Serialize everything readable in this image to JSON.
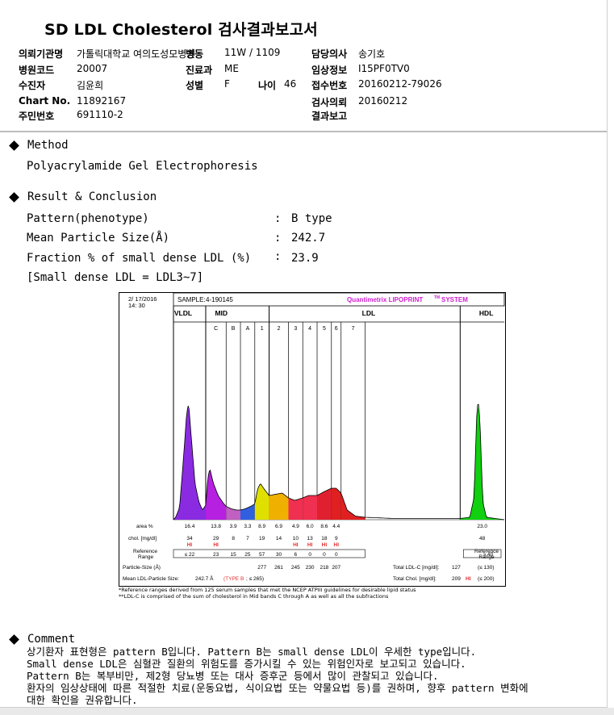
{
  "report": {
    "title": "SD LDL Cholesterol 검사결과보고서"
  },
  "header": {
    "fields": [
      {
        "label": "의뢰기관명",
        "value": "가톨릭대학교 여의도성모병원"
      },
      {
        "label": "병원코드",
        "value": "20007"
      },
      {
        "label": "수진자",
        "value": "김윤희"
      },
      {
        "label": "Chart No.",
        "value": "11892167"
      },
      {
        "label": "주민번호",
        "value": "691110-2"
      },
      {
        "label": "병동",
        "value": "11W / 1109"
      },
      {
        "label": "진료과",
        "value": "ME"
      },
      {
        "label": "성별",
        "value": "F"
      },
      {
        "label": "나이",
        "value": "46"
      },
      {
        "label": "담당의사",
        "value": "송기호"
      },
      {
        "label": "임상정보",
        "value": "I15PF0TV0"
      },
      {
        "label": "접수번호",
        "value": "20160212-79026"
      },
      {
        "label": "검사의뢰",
        "value": "20160212"
      },
      {
        "label": "결과보고",
        "value": ""
      }
    ]
  },
  "method": {
    "heading": "Method",
    "text": "Polyacrylamide Gel Electrophoresis"
  },
  "result": {
    "heading": "Result & Conclusion",
    "rows": [
      {
        "label": "Pattern(phenotype)",
        "value": "B type"
      },
      {
        "label": "Mean Particle Size(Å)",
        "value": "242.7"
      },
      {
        "label": "Fraction % of small dense LDL (%)",
        "value": "23.9"
      }
    ],
    "note": "[Small dense LDL = LDL3~7]"
  },
  "chart_data": {
    "type": "area",
    "date": "2/ 17/2016",
    "time": "14: 30",
    "sample_label": "SAMPLE:",
    "sample": "4-190145",
    "brand": "Quantimetrix LIPOPRINT",
    "brand_tm": "TM",
    "brand_suffix": "SYSTEM",
    "groups": [
      "VLDL",
      "MID",
      "LDL",
      "HDL"
    ],
    "bands": [
      "C",
      "B",
      "A",
      "1",
      "2",
      "3",
      "4",
      "5",
      "6",
      "7"
    ],
    "row_labels": {
      "area": "area %",
      "chol": "chol. [mg/dl]",
      "reference": "Reference Range",
      "particle_size": "Particle-Size (Å)",
      "mean_size": "Mean LDL-Particle Size:",
      "reference_right": "Reference Range"
    },
    "area_values": [
      "16.4",
      "13.8",
      "3.9",
      "3.3",
      "8.9",
      "6.9",
      "4.9",
      "6.0",
      "8.6",
      "4.4",
      "23.0"
    ],
    "chol_values": [
      "34",
      "29",
      "8",
      "7",
      "19",
      "14",
      "10",
      "13",
      "18",
      "9",
      "48"
    ],
    "hi_flags": [
      "HI",
      "HI",
      "HI",
      "HI",
      "HI",
      "HI"
    ],
    "reference_values": [
      "≤ 22",
      "23",
      "15",
      "25",
      "57",
      "30",
      "6",
      "0",
      "0",
      "0",
      "≥ 40"
    ],
    "particle_sizes": [
      "277",
      "261",
      "245",
      "230",
      "218",
      "207"
    ],
    "mean_size_value": "242.7 Å",
    "mean_size_type": "TYPE B",
    "mean_size_limit": "; ≤ 265",
    "total_ldl_label": "Total LDL-C [mg/dl]:",
    "total_ldl_value": "127",
    "total_ldl_ref": "(≤ 130)",
    "total_chol_label": "Total Chol. [mg/dl]:",
    "total_chol_value": "209",
    "total_chol_flag": "HI",
    "total_chol_ref": "(≤ 200)",
    "band_boundaries": [
      0,
      1.17,
      1.91,
      2.43,
      2.95,
      3.47,
      4.17,
      4.69,
      5.21,
      5.73,
      6.08,
      6.95,
      10.4,
      12.0
    ],
    "peaks": [
      {
        "band": "VLDL",
        "x": 0.55,
        "height": 0.96
      },
      {
        "band": "C",
        "x": 1.3,
        "height": 0.42
      },
      {
        "band": "LDL1",
        "x": 3.1,
        "height": 0.3
      },
      {
        "band": "HDL",
        "x": 11.05,
        "height": 1.0
      }
    ],
    "colors": {
      "VLDL": "#8a2be2",
      "C": "#b620e0",
      "B": "#c060c0",
      "A": "#3060e0",
      "LDL1": "#e0e000",
      "LDL2": "#f0b000",
      "LDL3": "#f03050",
      "LDL4": "#f03050",
      "LDL5": "#e02030",
      "LDL6": "#e02020",
      "HDL": "#10d010",
      "hi": "#e03030",
      "brand": "#d020d0"
    }
  },
  "chart_notes": [
    "*Reference ranges derived from 125 serum samples that met the NCEP ATPIII guidelines for desirable lipid status",
    "**LDL-C is comprised of the sum of cholesterol in Mid bands C through A as well as all the subfractions"
  ],
  "comment": {
    "heading": "Comment",
    "lines": [
      "상기환자 표현형은 pattern B입니다. Pattern B는 small dense LDL이 우세한 type입니다.",
      "Small dense LDL은 심혈관 질환의 위험도를 증가시킬 수 있는 위험인자로 보고되고 있습니다.",
      "Pattern B는 복부비만, 제2형 당뇨병 또는 대사 증후군 등에서 많이 관찰되고 있습니다.",
      "환자의 임상상태에 따른 적절한 치료(운동요법, 식이요법 또는 약물요법 등)를 권하며, 향후 pattern 변화에",
      "대한 확인을 권유합니다."
    ]
  }
}
